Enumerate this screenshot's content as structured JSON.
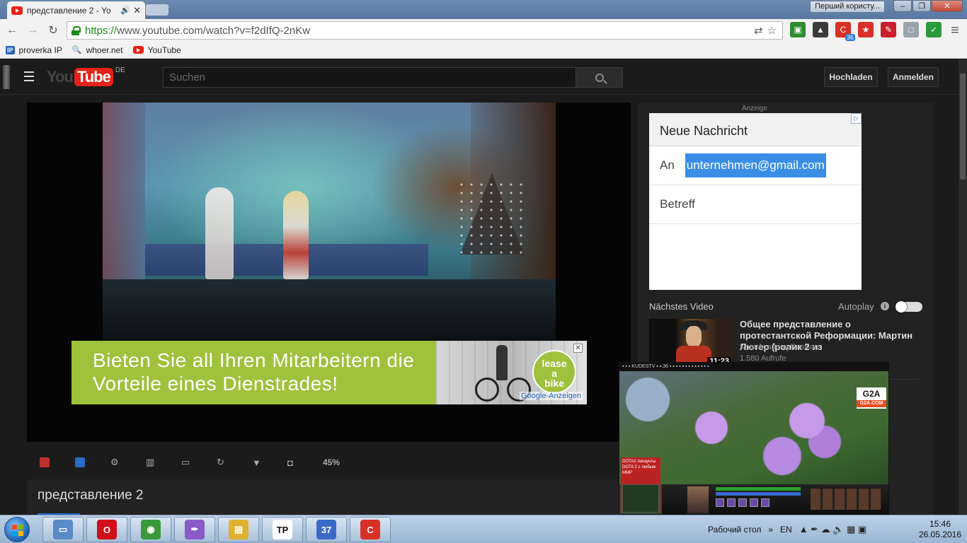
{
  "browser": {
    "tab_title": "представление 2 - Yo",
    "tab_sound": "🔊",
    "tab_close": "✕",
    "profile": "Перший користу...",
    "win_min": "–",
    "win_max": "❐",
    "win_close": "✕",
    "back": "←",
    "forward": "→",
    "reload": "↻",
    "url_secure": "https://",
    "url_rest": "www.youtube.com/watch?v=f2dIfQ-2nKw",
    "translate_icon": "⇄",
    "star": "☆",
    "menu": "≡",
    "ext_badge": "36",
    "extensions": [
      {
        "name": "tv-extension-icon",
        "color": "#2e8b2e",
        "glyph": "▣"
      },
      {
        "name": "hat-extension-icon",
        "color": "#3b3b3b",
        "glyph": "▲"
      },
      {
        "name": "c-extension-icon",
        "color": "#d93025",
        "glyph": "C"
      },
      {
        "name": "star-extension-icon",
        "color": "#d9302a",
        "glyph": "★"
      },
      {
        "name": "pin-extension-icon",
        "color": "#c8202a",
        "glyph": "✎"
      },
      {
        "name": "chat-extension-icon",
        "color": "#9aa3aa",
        "glyph": "□"
      },
      {
        "name": "shield-extension-icon",
        "color": "#2a9a3a",
        "glyph": "✓"
      }
    ]
  },
  "bookmarks": [
    {
      "label": "proverka IP",
      "icon": "IP"
    },
    {
      "label": "whoer.net",
      "icon": "🔍"
    },
    {
      "label": "YouTube",
      "icon": "yt"
    }
  ],
  "youtube": {
    "logo_you": "You",
    "logo_tube": "Tube",
    "logo_region": "DE",
    "search_placeholder": "Suchen",
    "upload": "Hochladen",
    "login": "Anmelden",
    "controls_percent": "45%",
    "video_title": "представление 2"
  },
  "overlay_ad": {
    "text": "Bieten Sie all Ihren Mitarbeitern die Vorteile eines Dienstrades!",
    "badge_line1": "lease",
    "badge_line2": "a",
    "badge_line3": "bike",
    "close": "✕",
    "google": "Google-Anzeigen"
  },
  "sidebar": {
    "anzeige": "Anzeige",
    "ad_icon": "▷",
    "mail_header": "Neue Nachricht",
    "to_label": "An",
    "to_value": "unternehmen@gmail.com",
    "subject": "Betreff",
    "next_label": "Nächstes Video",
    "autoplay": "Autoplay",
    "info": "i",
    "next_video": {
      "title": "Общее представление о протестантской Реформации: Мартин Лютер (ролик 2 из",
      "channel": "KhanAcademyRussian",
      "views": "1.580 Aufrufe",
      "duration": "11:23"
    }
  },
  "game": {
    "topbar": "▪ ▪ ▪ KUDESTV  ▪ ▪ 36 ▪ ▪ ▪ ▪ ▪ ▪ ▪ ▪ ▪ ▪ ▪ ▪ ▪",
    "g2a": "G2A",
    "g2a_sub": "G2A.COM",
    "promo": "DOTA2 Аккаунты DOTA 2 с любым ММР"
  },
  "taskbar": {
    "apps": [
      {
        "name": "explorer-window-icon",
        "color": "#5a8ac8",
        "glyph": "▭"
      },
      {
        "name": "opera-icon",
        "color": "#d0101a",
        "glyph": "O"
      },
      {
        "name": "chrome-icon",
        "color": "#3a9a3a",
        "glyph": "◉"
      },
      {
        "name": "feather-app-icon",
        "color": "#8a5ac8",
        "glyph": "✒"
      },
      {
        "name": "folder-icon",
        "color": "#e0b030",
        "glyph": "▤"
      },
      {
        "name": "tp-app-icon",
        "color": "#ffffff",
        "glyph": "TP"
      },
      {
        "name": "calendar-app-icon",
        "color": "#3a6ac8",
        "glyph": "37"
      },
      {
        "name": "c-app-icon",
        "color": "#d93025",
        "glyph": "C"
      }
    ],
    "desktop": "Рабочий стол",
    "lang": "EN",
    "tray_glyphs": "▲ ✒ ☁ 🔊 ▦ ▣",
    "time": "15:46",
    "date": "26.05.2016"
  }
}
